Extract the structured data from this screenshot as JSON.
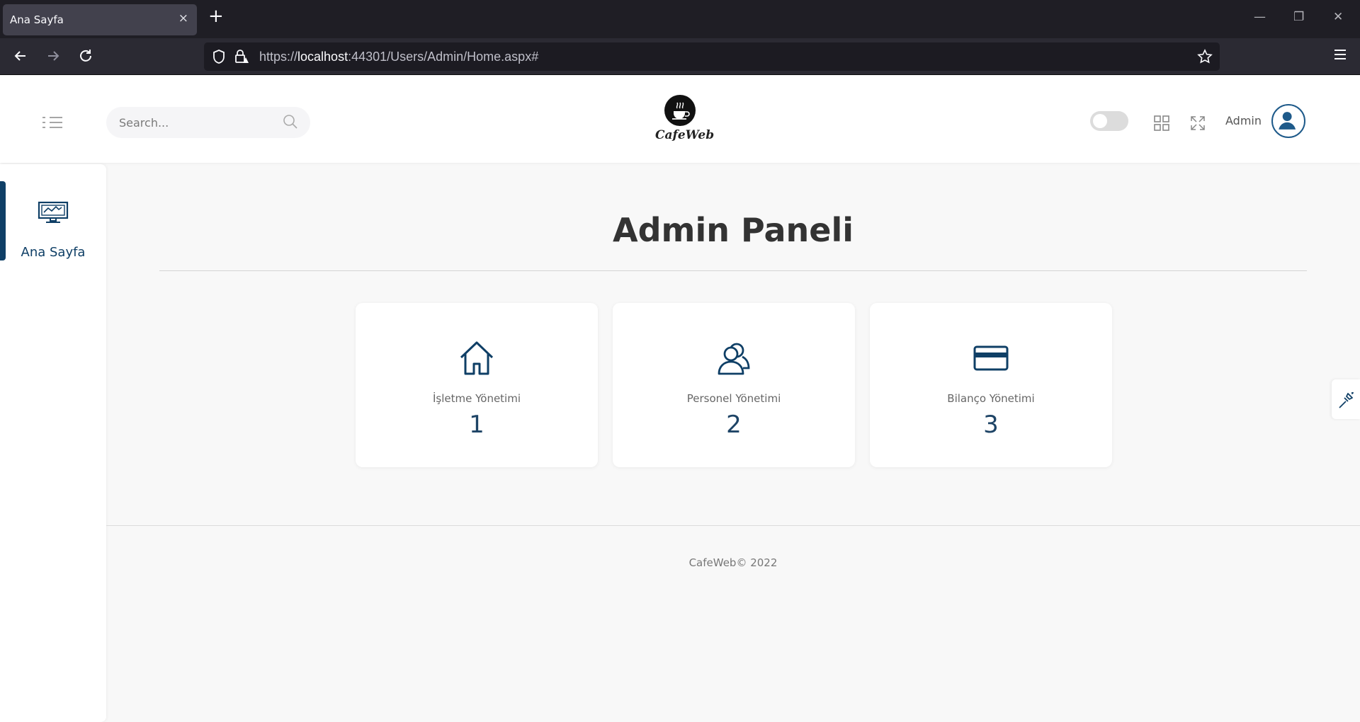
{
  "browser": {
    "tab_title": "Ana Sayfa",
    "tab_close": "×",
    "new_tab": "+",
    "url_prefix": "https://",
    "url_host": "localhost",
    "url_rest": ":44301/Users/Admin/Home.aspx#"
  },
  "header": {
    "search_placeholder": "Search...",
    "logo_text": "CafeWeb",
    "user_name": "Admin"
  },
  "sidebar": {
    "items": [
      {
        "label": "Ana Sayfa",
        "icon": "monitor-chart-icon",
        "active": true
      }
    ]
  },
  "main": {
    "title": "Admin Paneli",
    "cards": [
      {
        "label": "İşletme Yönetimi",
        "number": "1",
        "icon": "home-icon"
      },
      {
        "label": "Personel Yönetimi",
        "number": "2",
        "icon": "users-icon"
      },
      {
        "label": "Bilanço Yönetimi",
        "number": "3",
        "icon": "credit-card-icon"
      }
    ]
  },
  "footer": {
    "text": "CafeWeb© 2022"
  },
  "colors": {
    "accent": "#0f3f66",
    "card_number": "#1e4466"
  }
}
